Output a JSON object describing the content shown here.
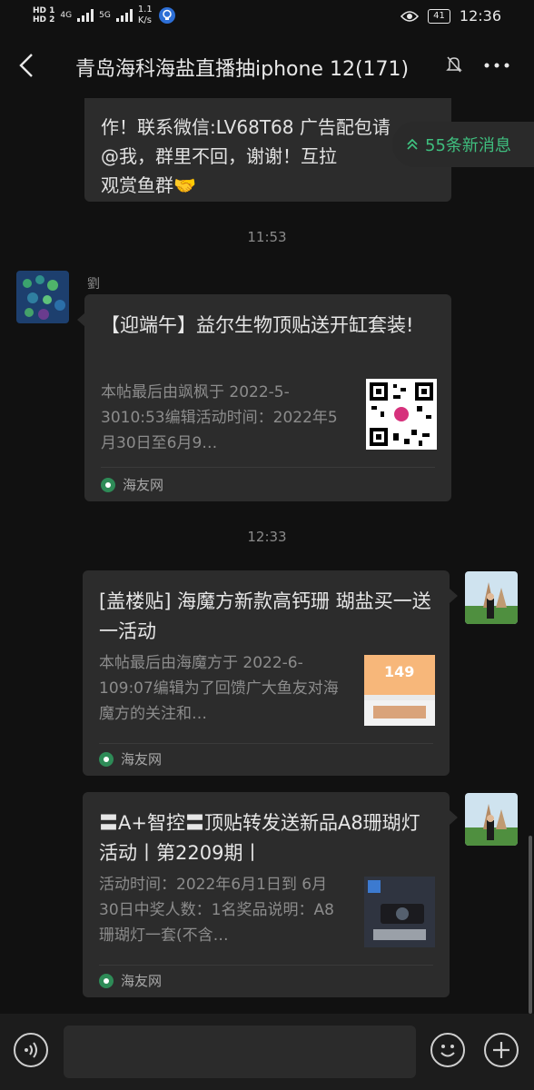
{
  "status_bar": {
    "hd1": "HD 1",
    "hd2": "HD 2",
    "net1": "4G",
    "net2": "5G",
    "speed_value": "1.1",
    "speed_unit": "K/s",
    "battery": "41",
    "time": "12:36"
  },
  "header": {
    "title": "青岛海科海盐直播抽iphone 12(171)"
  },
  "messages": {
    "partial_text_1": "作！联系微信:LV68T68 广告配包请",
    "partial_text_2": "@我，群里不回，谢谢！互拉",
    "partial_text_3": "观赏鱼群🤝",
    "new_messages": "55条新消息",
    "time1": "11:53",
    "sender1": "劉",
    "card1": {
      "title": "【迎端午】益尔生物顶贴送开缸套装!",
      "desc": "本帖最后由飒枫于 2022-5-3010:53编辑活动时间：2022年5月30日至6月9…",
      "source": "海友网"
    },
    "time2": "12:33",
    "card2": {
      "title": "[盖楼贴] 海魔方新款高钙珊 瑚盐买一送一活动",
      "desc": "本帖最后由海魔方于 2022-6-109:07编辑为了回馈广大鱼友对海魔方的关注和…",
      "source": "海友网",
      "thumb_text": "149"
    },
    "card3": {
      "title": "〓A+智控〓顶贴转发送新品A8珊瑚灯活动丨第2209期丨",
      "desc": "活动时间：2022年6月1日到 6月30日中奖人数：1名奖品说明：A8珊瑚灯一套(不含…",
      "source": "海友网"
    }
  },
  "icons": {
    "back": "back-arrow-icon",
    "mute": "bell-off-icon",
    "more": "more-dots-icon",
    "voice": "voice-icon",
    "emoji": "emoji-icon",
    "plus": "plus-icon"
  },
  "colors": {
    "background": "#111111",
    "bubble": "#2c2c2c",
    "accent_green": "#3fbf7f"
  }
}
